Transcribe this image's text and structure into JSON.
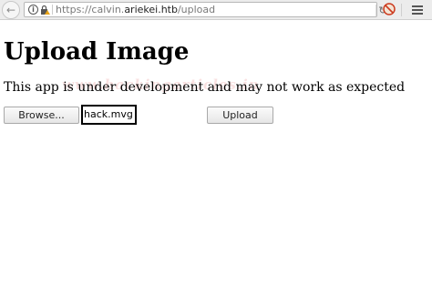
{
  "browser": {
    "url_prefix": "https://calvin.",
    "url_host": "ariekei.htb",
    "url_suffix": "/upload",
    "icons": {
      "back": "back-arrow-icon",
      "info": "info-icon",
      "lock": "lock-warning-icon",
      "reload": "reload-icon",
      "addon": "blocked-circle-icon",
      "menu": "hamburger-menu-icon"
    }
  },
  "page": {
    "title": "Upload Image",
    "subtitle": "This app is under development and may not work as expected",
    "watermark": "www.hackingarticles.in"
  },
  "form": {
    "browse_label": "Browse...",
    "selected_file": "hack.mvg",
    "upload_label": "Upload"
  }
}
